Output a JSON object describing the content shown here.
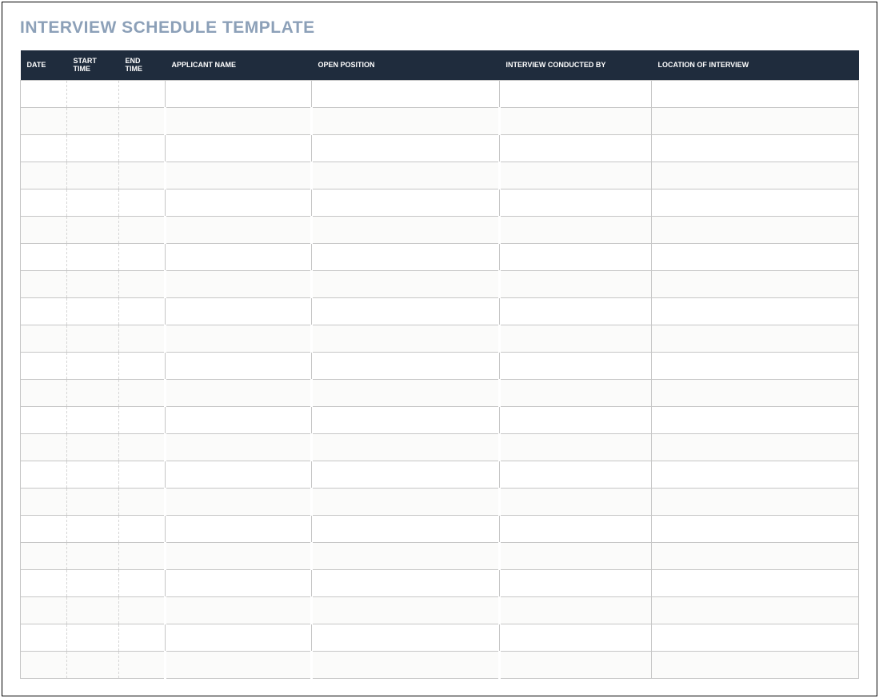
{
  "title": "INTERVIEW SCHEDULE TEMPLATE",
  "columns": {
    "date": "DATE",
    "start_time": "START TIME",
    "end_time": "END TIME",
    "applicant_name": "APPLICANT NAME",
    "open_position": "OPEN POSITION",
    "interview_conducted_by": "INTERVIEW CONDUCTED BY",
    "location_of_interview": "LOCATION OF INTERVIEW"
  },
  "rows": [
    {
      "date": "",
      "start_time": "",
      "end_time": "",
      "applicant_name": "",
      "open_position": "",
      "interview_conducted_by": "",
      "location_of_interview": ""
    },
    {
      "date": "",
      "start_time": "",
      "end_time": "",
      "applicant_name": "",
      "open_position": "",
      "interview_conducted_by": "",
      "location_of_interview": ""
    },
    {
      "date": "",
      "start_time": "",
      "end_time": "",
      "applicant_name": "",
      "open_position": "",
      "interview_conducted_by": "",
      "location_of_interview": ""
    },
    {
      "date": "",
      "start_time": "",
      "end_time": "",
      "applicant_name": "",
      "open_position": "",
      "interview_conducted_by": "",
      "location_of_interview": ""
    },
    {
      "date": "",
      "start_time": "",
      "end_time": "",
      "applicant_name": "",
      "open_position": "",
      "interview_conducted_by": "",
      "location_of_interview": ""
    },
    {
      "date": "",
      "start_time": "",
      "end_time": "",
      "applicant_name": "",
      "open_position": "",
      "interview_conducted_by": "",
      "location_of_interview": ""
    },
    {
      "date": "",
      "start_time": "",
      "end_time": "",
      "applicant_name": "",
      "open_position": "",
      "interview_conducted_by": "",
      "location_of_interview": ""
    },
    {
      "date": "",
      "start_time": "",
      "end_time": "",
      "applicant_name": "",
      "open_position": "",
      "interview_conducted_by": "",
      "location_of_interview": ""
    },
    {
      "date": "",
      "start_time": "",
      "end_time": "",
      "applicant_name": "",
      "open_position": "",
      "interview_conducted_by": "",
      "location_of_interview": ""
    },
    {
      "date": "",
      "start_time": "",
      "end_time": "",
      "applicant_name": "",
      "open_position": "",
      "interview_conducted_by": "",
      "location_of_interview": ""
    },
    {
      "date": "",
      "start_time": "",
      "end_time": "",
      "applicant_name": "",
      "open_position": "",
      "interview_conducted_by": "",
      "location_of_interview": ""
    },
    {
      "date": "",
      "start_time": "",
      "end_time": "",
      "applicant_name": "",
      "open_position": "",
      "interview_conducted_by": "",
      "location_of_interview": ""
    },
    {
      "date": "",
      "start_time": "",
      "end_time": "",
      "applicant_name": "",
      "open_position": "",
      "interview_conducted_by": "",
      "location_of_interview": ""
    },
    {
      "date": "",
      "start_time": "",
      "end_time": "",
      "applicant_name": "",
      "open_position": "",
      "interview_conducted_by": "",
      "location_of_interview": ""
    },
    {
      "date": "",
      "start_time": "",
      "end_time": "",
      "applicant_name": "",
      "open_position": "",
      "interview_conducted_by": "",
      "location_of_interview": ""
    },
    {
      "date": "",
      "start_time": "",
      "end_time": "",
      "applicant_name": "",
      "open_position": "",
      "interview_conducted_by": "",
      "location_of_interview": ""
    },
    {
      "date": "",
      "start_time": "",
      "end_time": "",
      "applicant_name": "",
      "open_position": "",
      "interview_conducted_by": "",
      "location_of_interview": ""
    },
    {
      "date": "",
      "start_time": "",
      "end_time": "",
      "applicant_name": "",
      "open_position": "",
      "interview_conducted_by": "",
      "location_of_interview": ""
    },
    {
      "date": "",
      "start_time": "",
      "end_time": "",
      "applicant_name": "",
      "open_position": "",
      "interview_conducted_by": "",
      "location_of_interview": ""
    },
    {
      "date": "",
      "start_time": "",
      "end_time": "",
      "applicant_name": "",
      "open_position": "",
      "interview_conducted_by": "",
      "location_of_interview": ""
    },
    {
      "date": "",
      "start_time": "",
      "end_time": "",
      "applicant_name": "",
      "open_position": "",
      "interview_conducted_by": "",
      "location_of_interview": ""
    },
    {
      "date": "",
      "start_time": "",
      "end_time": "",
      "applicant_name": "",
      "open_position": "",
      "interview_conducted_by": "",
      "location_of_interview": ""
    }
  ]
}
